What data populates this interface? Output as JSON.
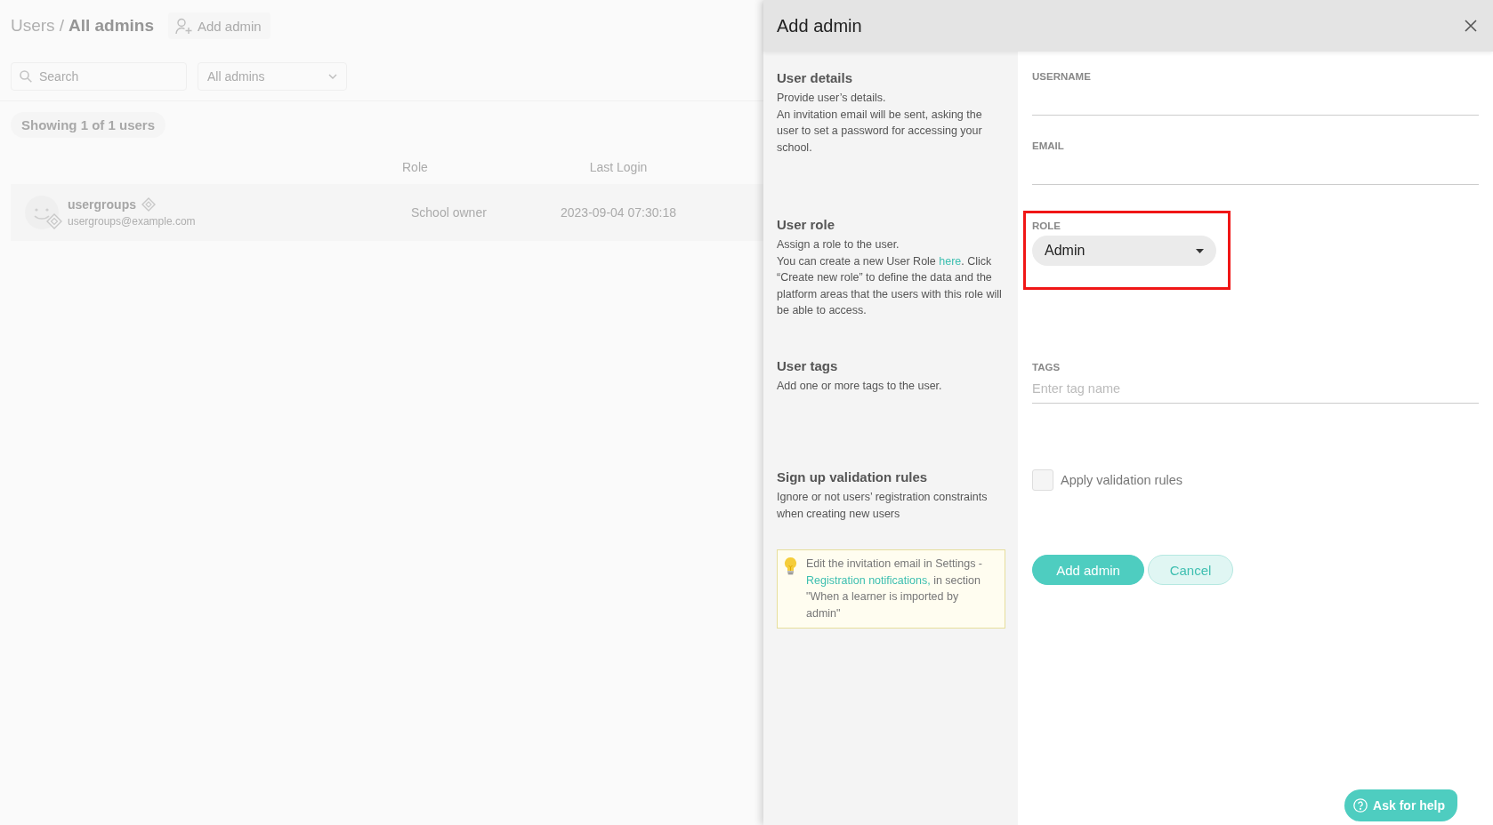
{
  "background_page": {
    "breadcrumb": {
      "parent": "Users",
      "separator": "/",
      "current": "All admins"
    },
    "add_button": "Add admin",
    "search": {
      "placeholder": "Search"
    },
    "filter": {
      "value": "All admins"
    },
    "result_count": "Showing 1 of 1 users",
    "table": {
      "columns": [
        "Role",
        "Last Login"
      ],
      "rows": [
        {
          "name": "usergroups",
          "email": "usergroups@example.com",
          "role": "School owner",
          "last_login": "2023-09-04 07:30:18"
        }
      ]
    }
  },
  "panel": {
    "title": "Add admin",
    "sections": [
      {
        "kind": "text_fields",
        "title": "User details",
        "description": [
          [
            {
              "kind": "text",
              "text": "Provide user’s details."
            }
          ],
          [
            {
              "kind": "text",
              "text": "An invitation email will be sent, asking the user to set a password for accessing your school."
            }
          ]
        ],
        "fields": [
          {
            "label": "USERNAME"
          },
          {
            "label": "EMAIL"
          }
        ]
      },
      {
        "kind": "select",
        "title": "User role",
        "description": [
          [
            {
              "kind": "text",
              "text": "Assign a role to the user."
            }
          ],
          [
            {
              "kind": "text",
              "text": "You can create a new User Role "
            },
            {
              "kind": "link",
              "text": "here"
            },
            {
              "kind": "text",
              "text": ". Click “Create new role” to define the data and the platform areas that the users with this role will be able to access."
            }
          ]
        ],
        "field": {
          "label": "ROLE",
          "value": "Admin",
          "highlighted": true
        }
      },
      {
        "kind": "tags",
        "title": "User tags",
        "description": [
          [
            {
              "kind": "text",
              "text": "Add one or more tags to the user."
            }
          ]
        ],
        "field": {
          "label": "TAGS",
          "placeholder": "Enter tag name"
        }
      },
      {
        "kind": "checkbox",
        "title": "Sign up validation rules",
        "description": [
          [
            {
              "kind": "text",
              "text": "Ignore or not users’ registration constraints when creating new users"
            }
          ]
        ],
        "checkbox": {
          "label": "Apply validation rules",
          "checked": false
        }
      }
    ],
    "tip": [
      {
        "kind": "text",
        "text": "Edit the invitation email in Settings - "
      },
      {
        "kind": "link",
        "text": "Registration notifications,"
      },
      {
        "kind": "text",
        "text": " in section \"When a learner is imported by admin\""
      }
    ],
    "buttons": [
      {
        "label": "Add admin",
        "kind": "primary"
      },
      {
        "label": "Cancel",
        "kind": "secondary"
      }
    ]
  },
  "help_button": {
    "label": "Ask for help"
  }
}
